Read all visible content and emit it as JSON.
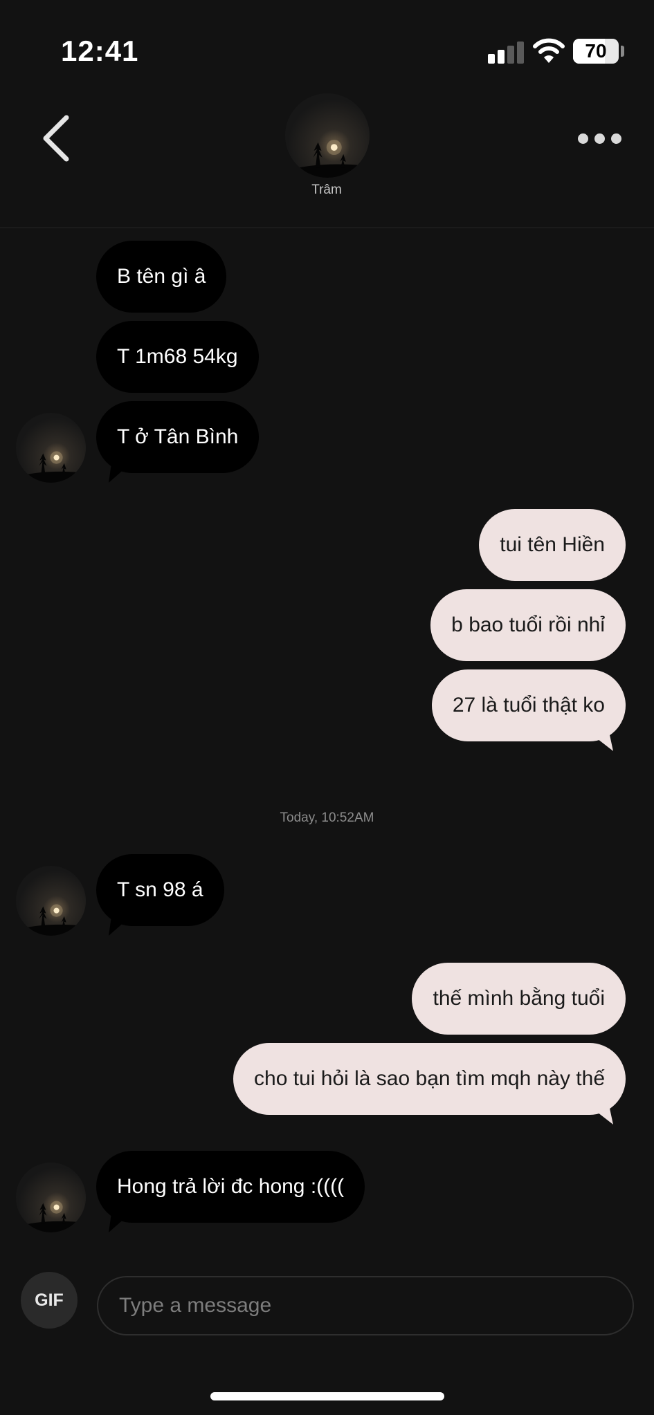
{
  "status_bar": {
    "time": "12:41",
    "battery_percent": "70",
    "battery_level": 0.7,
    "icons": [
      "signal-icon",
      "wifi-icon",
      "battery-icon"
    ]
  },
  "header": {
    "contact_name": "Trâm",
    "back_icon": "chevron-left-icon",
    "more_icon": "more-horizontal-icon"
  },
  "messages": [
    {
      "sender": "contact",
      "text": "B tên gì â"
    },
    {
      "sender": "contact",
      "text": "T 1m68 54kg"
    },
    {
      "sender": "contact",
      "text": "T ở Tân Bình"
    },
    {
      "sender": "me",
      "text": "tui tên Hiền"
    },
    {
      "sender": "me",
      "text": "b bao tuổi rồi nhỉ"
    },
    {
      "sender": "me",
      "text": "27 là tuổi thật ko"
    },
    {
      "type": "timestamp",
      "text": "Today, 10:52AM"
    },
    {
      "sender": "contact",
      "text": "T sn 98 á"
    },
    {
      "sender": "me",
      "text": "thế mình bằng tuổi"
    },
    {
      "sender": "me",
      "text": "cho tui hỏi là sao bạn tìm mqh này thế"
    },
    {
      "sender": "contact",
      "text": "Hong trả lời đc hong :(((("
    }
  ],
  "composer": {
    "gif_label": "GIF",
    "placeholder": "Type a message",
    "value": ""
  },
  "colors": {
    "background": "#121212",
    "incoming_bubble": "#000000",
    "outgoing_bubble": "#efe2e1",
    "outgoing_text": "#1a1a1a"
  }
}
